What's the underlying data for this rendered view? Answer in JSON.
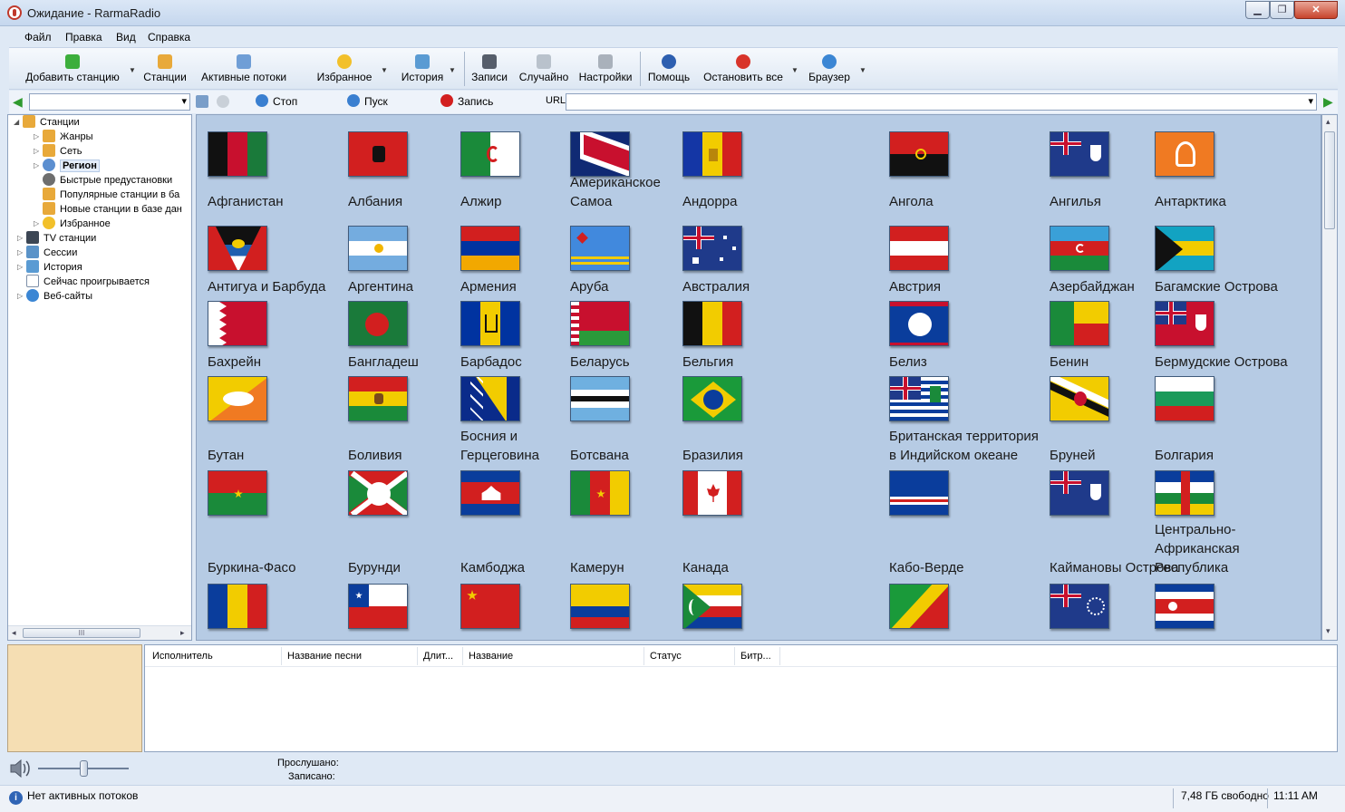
{
  "window": {
    "title": "Ожидание - RarmaRadio",
    "minimize": "▁",
    "maximize": "❐",
    "close": "✕"
  },
  "menu": [
    "Файл",
    "Правка",
    "Вид",
    "Справка"
  ],
  "toolbar": {
    "add_station": "Добавить станцию",
    "stations": "Станции",
    "active_streams": "Активные потоки",
    "favorites": "Избранное",
    "history": "История",
    "recordings": "Записи",
    "random": "Случайно",
    "settings": "Настройки",
    "help": "Помощь",
    "stop_all": "Остановить все",
    "browser": "Браузер"
  },
  "addressbar": {
    "stop": "Стоп",
    "play": "Пуск",
    "record": "Запись",
    "url_label": "URL",
    "url_value": ""
  },
  "tree": [
    {
      "label": "Станции"
    },
    {
      "label": "Жанры"
    },
    {
      "label": "Сеть"
    },
    {
      "label": "Регион"
    },
    {
      "label": "Быстрые предустановки"
    },
    {
      "label": "Популярные станции в ба"
    },
    {
      "label": "Новые станции в базе дан"
    },
    {
      "label": "Избранное"
    },
    {
      "label": "TV станции"
    },
    {
      "label": "Сессии"
    },
    {
      "label": "История"
    },
    {
      "label": "Сейчас проигрывается"
    },
    {
      "label": "Веб-сайты"
    }
  ],
  "countries": [
    {
      "name": "Афганистан",
      "flag": "afghanistan"
    },
    {
      "name": "Албания",
      "flag": "albania"
    },
    {
      "name": "Алжир",
      "flag": "algeria"
    },
    {
      "name": "Американское Самоа",
      "flag": "american-samoa"
    },
    {
      "name": "Андорра",
      "flag": "andorra"
    },
    {
      "name": "Ангола",
      "flag": "angola"
    },
    {
      "name": "Ангилья",
      "flag": "anguilla"
    },
    {
      "name": "Антарктика",
      "flag": "antarctica"
    },
    {
      "name": "Антигуа и Барбуда",
      "flag": "antigua"
    },
    {
      "name": "Аргентина",
      "flag": "argentina"
    },
    {
      "name": "Армения",
      "flag": "armenia"
    },
    {
      "name": "Аруба",
      "flag": "aruba"
    },
    {
      "name": "Австралия",
      "flag": "australia"
    },
    {
      "name": "Австрия",
      "flag": "austria"
    },
    {
      "name": "Азербайджан",
      "flag": "azerbaijan"
    },
    {
      "name": "Багамские Острова",
      "flag": "bahamas"
    },
    {
      "name": "Бахрейн",
      "flag": "bahrain"
    },
    {
      "name": "Бангладеш",
      "flag": "bangladesh"
    },
    {
      "name": "Барбадос",
      "flag": "barbados"
    },
    {
      "name": "Беларусь",
      "flag": "belarus"
    },
    {
      "name": "Бельгия",
      "flag": "belgium"
    },
    {
      "name": "Белиз",
      "flag": "belize"
    },
    {
      "name": "Бенин",
      "flag": "benin"
    },
    {
      "name": "Бермудские Острова",
      "flag": "bermuda"
    },
    {
      "name": "Бутан",
      "flag": "bhutan"
    },
    {
      "name": "Боливия",
      "flag": "bolivia"
    },
    {
      "name": "Босния и Герцеговина",
      "flag": "bosnia"
    },
    {
      "name": "Ботсвана",
      "flag": "botswana"
    },
    {
      "name": "Бразилия",
      "flag": "brazil"
    },
    {
      "name": "Британская территория в Индийском океане",
      "flag": "biot"
    },
    {
      "name": "Бруней",
      "flag": "brunei"
    },
    {
      "name": "Болгария",
      "flag": "bulgaria"
    },
    {
      "name": "Буркина-Фасо",
      "flag": "burkina-faso"
    },
    {
      "name": "Бурунди",
      "flag": "burundi"
    },
    {
      "name": "Камбоджа",
      "flag": "cambodia"
    },
    {
      "name": "Камерун",
      "flag": "cameroon"
    },
    {
      "name": "Канада",
      "flag": "canada"
    },
    {
      "name": "Кабо-Верде",
      "flag": "cape-verde"
    },
    {
      "name": "Каймановы Острова",
      "flag": "cayman"
    },
    {
      "name": "Центрально-Африканская Республика",
      "flag": "car"
    },
    {
      "name": "",
      "flag": "chad"
    },
    {
      "name": "",
      "flag": "chile"
    },
    {
      "name": "",
      "flag": "china"
    },
    {
      "name": "",
      "flag": "colombia"
    },
    {
      "name": "",
      "flag": "comoros"
    },
    {
      "name": "",
      "flag": "congo"
    },
    {
      "name": "",
      "flag": "cook-islands"
    },
    {
      "name": "",
      "flag": "costa-rica"
    }
  ],
  "songs_table": {
    "columns": [
      "Исполнитель",
      "Название песни",
      "Длит...",
      "Название",
      "Статус",
      "Битр..."
    ]
  },
  "player": {
    "listened_label": "Прослушано:",
    "recorded_label": "Записано:"
  },
  "status": {
    "text": "Нет активных потоков",
    "disk": "7,48 ГБ свободно",
    "time": "11:11 AM"
  }
}
